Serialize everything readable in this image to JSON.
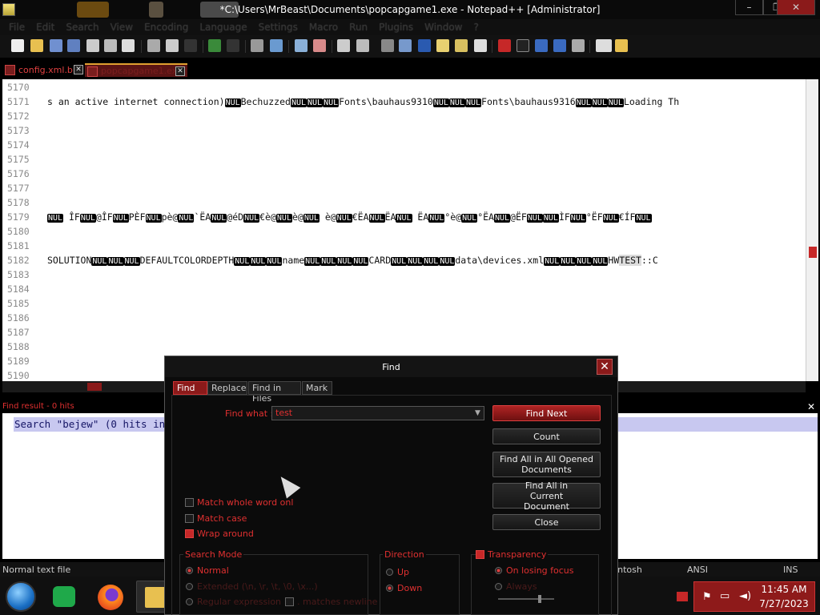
{
  "window": {
    "title": "*C:\\Users\\MrBeast\\Documents\\popcapgame1.exe - Notepad++ [Administrator]",
    "controls": {
      "minimize": "–",
      "maximize": "❐",
      "close": "✕"
    }
  },
  "menu": [
    "File",
    "Edit",
    "Search",
    "View",
    "Encoding",
    "Language",
    "Settings",
    "Macro",
    "Run",
    "Plugins",
    "Window",
    "?"
  ],
  "tabs": [
    {
      "label": "config.xml.bin",
      "active": false
    },
    {
      "label": "popcapgame1.exe",
      "active": true
    }
  ],
  "editor": {
    "line_numbers": [
      "5170",
      "5171",
      "5172",
      "5173",
      "5174",
      "5175",
      "5176",
      "5177",
      "5178",
      "5179",
      "5180",
      "5181",
      "5182",
      "5183",
      "5184",
      "5185",
      "5186",
      "5187",
      "5188",
      "5189",
      "5190"
    ],
    "line_5171": [
      {
        "t": "s an active internet connection)"
      },
      {
        "nul": "NUL"
      },
      {
        "t": "Bechuzzed"
      },
      {
        "nul": "NUL"
      },
      {
        "nul": "NUL"
      },
      {
        "nul": "NUL"
      },
      {
        "t": "Fonts\\bauhaus9310"
      },
      {
        "nul": "NUL"
      },
      {
        "nul": "NUL"
      },
      {
        "nul": "NUL"
      },
      {
        "t": "Fonts\\bauhaus9316"
      },
      {
        "nul": "NUL"
      },
      {
        "nul": "NUL"
      },
      {
        "nul": "NUL"
      },
      {
        "t": "Loading Th"
      }
    ],
    "line_5179": [
      {
        "nul": "NUL"
      },
      {
        "t": " ÎF"
      },
      {
        "nul": "NUL"
      },
      {
        "t": "@ÎF"
      },
      {
        "nul": "NUL"
      },
      {
        "t": "PÈF"
      },
      {
        "nul": "NUL"
      },
      {
        "t": "pè@"
      },
      {
        "nul": "NUL"
      },
      {
        "t": "`ËA"
      },
      {
        "nul": "NUL"
      },
      {
        "t": "@éD"
      },
      {
        "nul": "NUL"
      },
      {
        "t": "€è@"
      },
      {
        "nul": "NUL"
      },
      {
        "t": "è@"
      },
      {
        "nul": "NUL"
      },
      {
        "t": " è@"
      },
      {
        "nul": "NUL"
      },
      {
        "t": "€ËA"
      },
      {
        "nul": "NUL"
      },
      {
        "t": "ËA"
      },
      {
        "nul": "NUL"
      },
      {
        "t": " ËA"
      },
      {
        "nul": "NUL"
      },
      {
        "t": "°è@"
      },
      {
        "nul": "NUL"
      },
      {
        "t": "°ËA"
      },
      {
        "nul": "NUL"
      },
      {
        "t": "@ËF"
      },
      {
        "nul": "NUL"
      },
      {
        "nul": "NUL"
      },
      {
        "t": "ÌF"
      },
      {
        "nul": "NUL"
      },
      {
        "t": "°ËF"
      },
      {
        "nul": "NUL"
      },
      {
        "t": "€ÍF"
      },
      {
        "nul": "NUL"
      }
    ],
    "line_5182": [
      {
        "t": "SOLUTION"
      },
      {
        "nul": "NUL"
      },
      {
        "nul": "NUL"
      },
      {
        "nul": "NUL"
      },
      {
        "t": "DEFAULTCOLORDEPTH"
      },
      {
        "nul": "NUL"
      },
      {
        "nul": "NUL"
      },
      {
        "nul": "NUL"
      },
      {
        "t": "name"
      },
      {
        "nul": "NUL"
      },
      {
        "nul": "NUL"
      },
      {
        "nul": "NUL"
      },
      {
        "nul": "NUL"
      },
      {
        "t": "CARD"
      },
      {
        "nul": "NUL"
      },
      {
        "nul": "NUL"
      },
      {
        "nul": "NUL"
      },
      {
        "nul": "NUL"
      },
      {
        "t": "data\\devices.xml"
      },
      {
        "nul": "NUL"
      },
      {
        "nul": "NUL"
      },
      {
        "nul": "NUL"
      },
      {
        "nul": "NUL"
      },
      {
        "t": "HW"
      },
      {
        "hl": "TEST"
      },
      {
        "t": "::C"
      }
    ]
  },
  "find_result": {
    "title": "Find result - 0 hits",
    "line": "Search \"bejew\" (0 hits in"
  },
  "statusbar": {
    "file_type": "Normal text file",
    "eol": "cintosh",
    "encoding": "ANSI",
    "mode": "INS"
  },
  "taskbar": {
    "apps": [
      "firefox",
      "file-explorer",
      "remote-desktop",
      "notepad-plus-plus"
    ],
    "time": "11:45 AM",
    "date": "7/27/2023"
  },
  "find_dialog": {
    "title": "Find",
    "close": "✕",
    "tabs": [
      "Find",
      "Replace",
      "Find in Files",
      "Mark"
    ],
    "find_what_label": "Find what :",
    "find_what_value": "test",
    "buttons": {
      "find_next": "Find Next",
      "count": "Count",
      "find_all_opened": "Find All in All Opened Documents",
      "find_all_current": "Find All in Current Document",
      "close": "Close"
    },
    "options": {
      "match_whole_word": {
        "label": "Match whole word onl",
        "checked": false
      },
      "match_case": {
        "label": "Match case",
        "checked": false
      },
      "wrap_around": {
        "label": "Wrap around",
        "checked": true
      }
    },
    "search_mode": {
      "label": "Search Mode",
      "normal": "Normal",
      "extended": "Extended (\\n, \\r, \\t, \\0, \\x...)",
      "regex": "Regular expression",
      "matches_newline": ". matches newline"
    },
    "direction": {
      "label": "Direction",
      "up": "Up",
      "down": "Down"
    },
    "transparency": {
      "label": "Transparency",
      "checked": true,
      "on_losing_focus": "On losing focus",
      "always": "Always"
    }
  },
  "colors": {
    "accent": "#c62828",
    "nul_bg": "#000000",
    "result_highlight": "#c8c8f0"
  }
}
